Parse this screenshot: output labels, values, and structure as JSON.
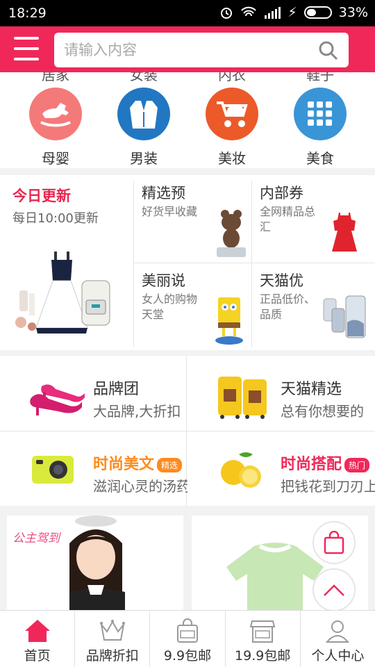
{
  "status": {
    "time": "18:29",
    "battery": "33%"
  },
  "header": {
    "search_placeholder": "请输入内容"
  },
  "categories_partial": [
    "居家",
    "女装",
    "内衣",
    "鞋子"
  ],
  "categories": [
    {
      "label": "母婴",
      "icon": "rocking-horse-icon",
      "color": "#f47a7a"
    },
    {
      "label": "男装",
      "icon": "suit-icon",
      "color": "#2277c2"
    },
    {
      "label": "美妆",
      "icon": "stroller-icon",
      "color": "#ec5a2a"
    },
    {
      "label": "美食",
      "icon": "grid-icon",
      "color": "#3a95d6"
    }
  ],
  "daily": {
    "title": "今日更新",
    "subtitle": "每日10:00更新",
    "cells": [
      {
        "title": "精选预",
        "sub": "好货早收藏",
        "icon": "bear-figure-icon"
      },
      {
        "title": "内部券",
        "sub": "全网精品总汇",
        "icon": "red-dress-icon"
      },
      {
        "title": "美丽说",
        "sub": "女人的购物天堂",
        "icon": "sponge-figure-icon"
      },
      {
        "title": "天猫优",
        "sub": "正品低价、品质",
        "icon": "phone-case-icon"
      }
    ]
  },
  "brands": [
    {
      "title": "品牌团",
      "sub": "大品牌,大折扣",
      "icon": "heels-icon"
    },
    {
      "title": "天猫精选",
      "sub": "总有你想要的",
      "icon": "luggage-icon"
    },
    {
      "title": "时尚美文",
      "tag": "精选",
      "sub": "滋润心灵的汤药",
      "icon": "camera-icon"
    },
    {
      "title": "时尚搭配",
      "tag": "热门",
      "sub": "把钱花到刀刃上",
      "icon": "lemon-icon"
    }
  ],
  "promo": {
    "left_text": "公主驾到"
  },
  "tabs": [
    {
      "label": "首页",
      "icon": "home-icon"
    },
    {
      "label": "品牌折扣",
      "icon": "crown-icon"
    },
    {
      "label": "9.9包邮",
      "icon": "bag-99-icon"
    },
    {
      "label": "19.9包邮",
      "icon": "shop-199-icon"
    },
    {
      "label": "个人中心",
      "icon": "user-icon"
    }
  ]
}
